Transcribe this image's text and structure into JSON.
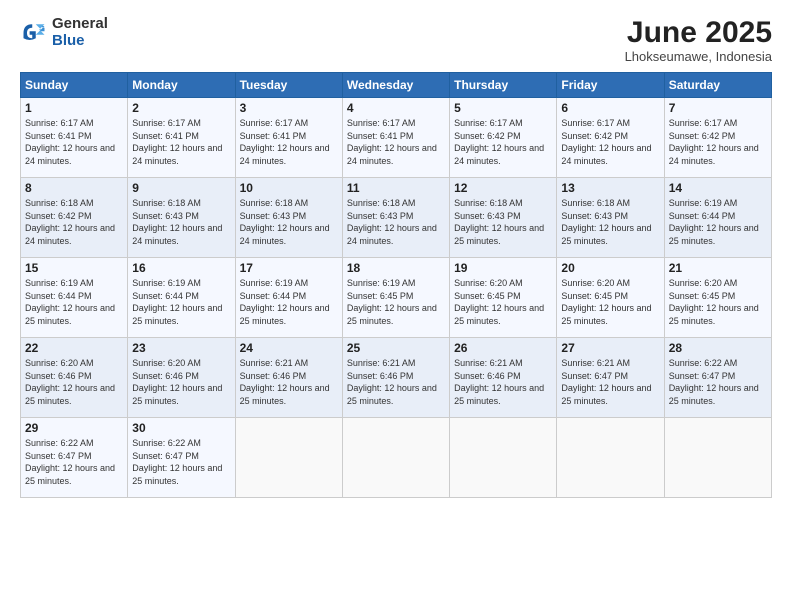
{
  "logo": {
    "general": "General",
    "blue": "Blue"
  },
  "header": {
    "title": "June 2025",
    "location": "Lhokseumawe, Indonesia"
  },
  "weekdays": [
    "Sunday",
    "Monday",
    "Tuesday",
    "Wednesday",
    "Thursday",
    "Friday",
    "Saturday"
  ],
  "weeks": [
    [
      {
        "day": "1",
        "sunrise": "Sunrise: 6:17 AM",
        "sunset": "Sunset: 6:41 PM",
        "daylight": "Daylight: 12 hours and 24 minutes."
      },
      {
        "day": "2",
        "sunrise": "Sunrise: 6:17 AM",
        "sunset": "Sunset: 6:41 PM",
        "daylight": "Daylight: 12 hours and 24 minutes."
      },
      {
        "day": "3",
        "sunrise": "Sunrise: 6:17 AM",
        "sunset": "Sunset: 6:41 PM",
        "daylight": "Daylight: 12 hours and 24 minutes."
      },
      {
        "day": "4",
        "sunrise": "Sunrise: 6:17 AM",
        "sunset": "Sunset: 6:41 PM",
        "daylight": "Daylight: 12 hours and 24 minutes."
      },
      {
        "day": "5",
        "sunrise": "Sunrise: 6:17 AM",
        "sunset": "Sunset: 6:42 PM",
        "daylight": "Daylight: 12 hours and 24 minutes."
      },
      {
        "day": "6",
        "sunrise": "Sunrise: 6:17 AM",
        "sunset": "Sunset: 6:42 PM",
        "daylight": "Daylight: 12 hours and 24 minutes."
      },
      {
        "day": "7",
        "sunrise": "Sunrise: 6:17 AM",
        "sunset": "Sunset: 6:42 PM",
        "daylight": "Daylight: 12 hours and 24 minutes."
      }
    ],
    [
      {
        "day": "8",
        "sunrise": "Sunrise: 6:18 AM",
        "sunset": "Sunset: 6:42 PM",
        "daylight": "Daylight: 12 hours and 24 minutes."
      },
      {
        "day": "9",
        "sunrise": "Sunrise: 6:18 AM",
        "sunset": "Sunset: 6:43 PM",
        "daylight": "Daylight: 12 hours and 24 minutes."
      },
      {
        "day": "10",
        "sunrise": "Sunrise: 6:18 AM",
        "sunset": "Sunset: 6:43 PM",
        "daylight": "Daylight: 12 hours and 24 minutes."
      },
      {
        "day": "11",
        "sunrise": "Sunrise: 6:18 AM",
        "sunset": "Sunset: 6:43 PM",
        "daylight": "Daylight: 12 hours and 24 minutes."
      },
      {
        "day": "12",
        "sunrise": "Sunrise: 6:18 AM",
        "sunset": "Sunset: 6:43 PM",
        "daylight": "Daylight: 12 hours and 25 minutes."
      },
      {
        "day": "13",
        "sunrise": "Sunrise: 6:18 AM",
        "sunset": "Sunset: 6:43 PM",
        "daylight": "Daylight: 12 hours and 25 minutes."
      },
      {
        "day": "14",
        "sunrise": "Sunrise: 6:19 AM",
        "sunset": "Sunset: 6:44 PM",
        "daylight": "Daylight: 12 hours and 25 minutes."
      }
    ],
    [
      {
        "day": "15",
        "sunrise": "Sunrise: 6:19 AM",
        "sunset": "Sunset: 6:44 PM",
        "daylight": "Daylight: 12 hours and 25 minutes."
      },
      {
        "day": "16",
        "sunrise": "Sunrise: 6:19 AM",
        "sunset": "Sunset: 6:44 PM",
        "daylight": "Daylight: 12 hours and 25 minutes."
      },
      {
        "day": "17",
        "sunrise": "Sunrise: 6:19 AM",
        "sunset": "Sunset: 6:44 PM",
        "daylight": "Daylight: 12 hours and 25 minutes."
      },
      {
        "day": "18",
        "sunrise": "Sunrise: 6:19 AM",
        "sunset": "Sunset: 6:45 PM",
        "daylight": "Daylight: 12 hours and 25 minutes."
      },
      {
        "day": "19",
        "sunrise": "Sunrise: 6:20 AM",
        "sunset": "Sunset: 6:45 PM",
        "daylight": "Daylight: 12 hours and 25 minutes."
      },
      {
        "day": "20",
        "sunrise": "Sunrise: 6:20 AM",
        "sunset": "Sunset: 6:45 PM",
        "daylight": "Daylight: 12 hours and 25 minutes."
      },
      {
        "day": "21",
        "sunrise": "Sunrise: 6:20 AM",
        "sunset": "Sunset: 6:45 PM",
        "daylight": "Daylight: 12 hours and 25 minutes."
      }
    ],
    [
      {
        "day": "22",
        "sunrise": "Sunrise: 6:20 AM",
        "sunset": "Sunset: 6:46 PM",
        "daylight": "Daylight: 12 hours and 25 minutes."
      },
      {
        "day": "23",
        "sunrise": "Sunrise: 6:20 AM",
        "sunset": "Sunset: 6:46 PM",
        "daylight": "Daylight: 12 hours and 25 minutes."
      },
      {
        "day": "24",
        "sunrise": "Sunrise: 6:21 AM",
        "sunset": "Sunset: 6:46 PM",
        "daylight": "Daylight: 12 hours and 25 minutes."
      },
      {
        "day": "25",
        "sunrise": "Sunrise: 6:21 AM",
        "sunset": "Sunset: 6:46 PM",
        "daylight": "Daylight: 12 hours and 25 minutes."
      },
      {
        "day": "26",
        "sunrise": "Sunrise: 6:21 AM",
        "sunset": "Sunset: 6:46 PM",
        "daylight": "Daylight: 12 hours and 25 minutes."
      },
      {
        "day": "27",
        "sunrise": "Sunrise: 6:21 AM",
        "sunset": "Sunset: 6:47 PM",
        "daylight": "Daylight: 12 hours and 25 minutes."
      },
      {
        "day": "28",
        "sunrise": "Sunrise: 6:22 AM",
        "sunset": "Sunset: 6:47 PM",
        "daylight": "Daylight: 12 hours and 25 minutes."
      }
    ],
    [
      {
        "day": "29",
        "sunrise": "Sunrise: 6:22 AM",
        "sunset": "Sunset: 6:47 PM",
        "daylight": "Daylight: 12 hours and 25 minutes."
      },
      {
        "day": "30",
        "sunrise": "Sunrise: 6:22 AM",
        "sunset": "Sunset: 6:47 PM",
        "daylight": "Daylight: 12 hours and 25 minutes."
      },
      {
        "day": "",
        "sunrise": "",
        "sunset": "",
        "daylight": ""
      },
      {
        "day": "",
        "sunrise": "",
        "sunset": "",
        "daylight": ""
      },
      {
        "day": "",
        "sunrise": "",
        "sunset": "",
        "daylight": ""
      },
      {
        "day": "",
        "sunrise": "",
        "sunset": "",
        "daylight": ""
      },
      {
        "day": "",
        "sunrise": "",
        "sunset": "",
        "daylight": ""
      }
    ]
  ]
}
